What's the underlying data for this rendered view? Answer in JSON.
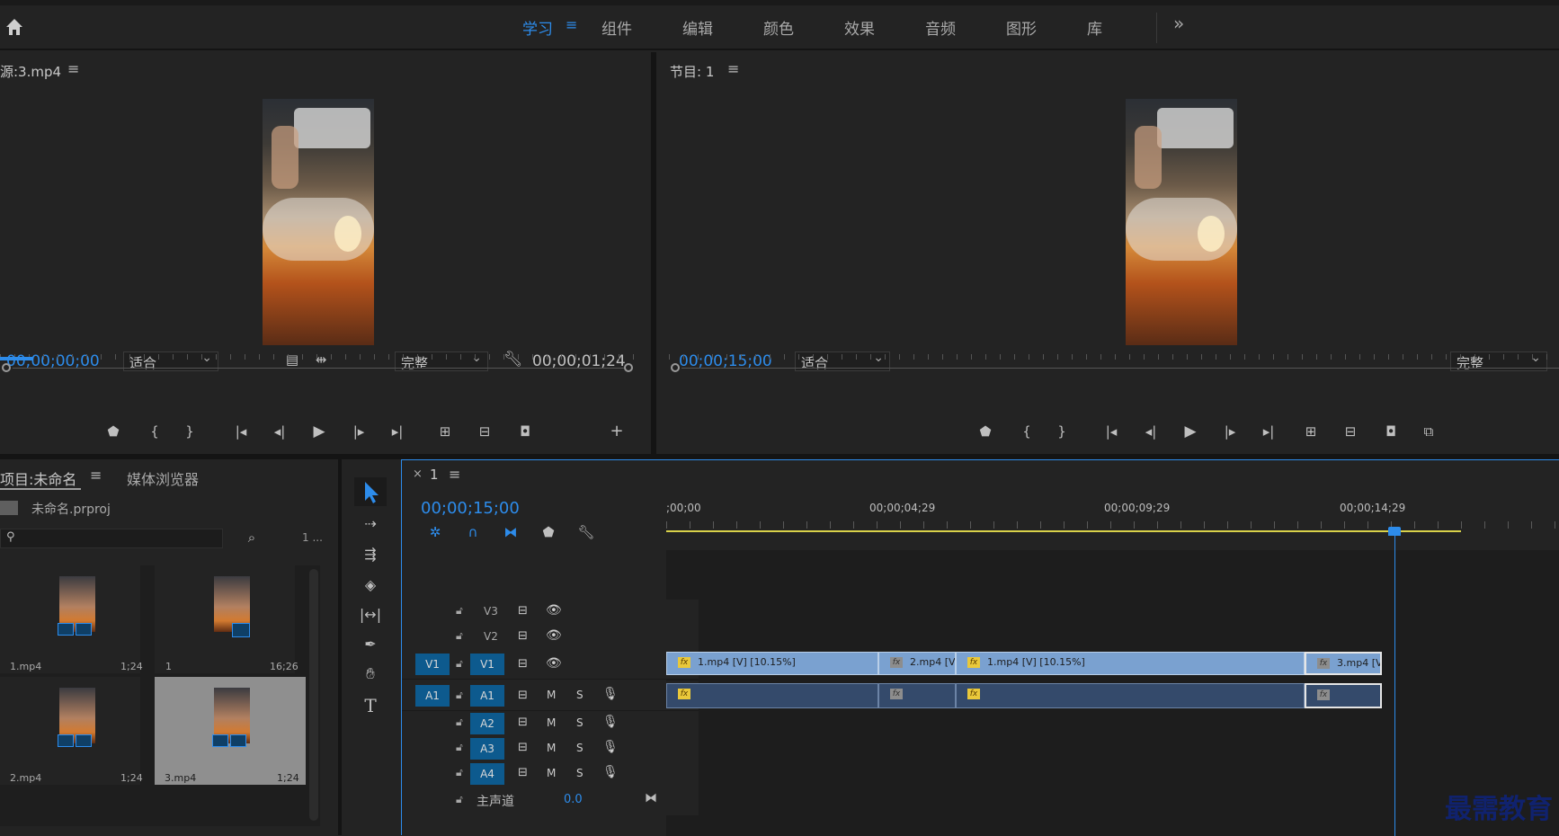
{
  "workspaces": {
    "tabs": [
      "学习",
      "组件",
      "编辑",
      "颜色",
      "效果",
      "音频",
      "图形",
      "库"
    ],
    "active": "学习",
    "more": "»"
  },
  "source": {
    "title": "源:3.mp4",
    "timecode": "00;00;00;00",
    "fit": "适合",
    "quality": "完整",
    "duration": "00;00;01;24"
  },
  "program": {
    "title": "节目: 1",
    "timecode": "00;00;15;00",
    "fit": "适合",
    "quality": "完整"
  },
  "project": {
    "tab_project": "项目:未命名",
    "tab_media": "媒体浏览器",
    "file": "未命名.prproj",
    "count": "1 ...",
    "items": [
      {
        "name": "1.mp4",
        "duration": "1;24"
      },
      {
        "name": "1",
        "duration": "16;26"
      },
      {
        "name": "2.mp4",
        "duration": "1;24"
      },
      {
        "name": "3.mp4",
        "duration": "1;24"
      }
    ]
  },
  "timeline": {
    "sequence": "1",
    "timecode": "00;00;15;00",
    "ruler": [
      ";00;00",
      "00;00;04;29",
      "00;00;09;29",
      "00;00;14;29"
    ],
    "playhead_fraction": 0.815,
    "video_tracks": [
      "V3",
      "V2",
      "V1"
    ],
    "audio_tracks": [
      "A1",
      "A2",
      "A3",
      "A4"
    ],
    "source_patch_v": "V1",
    "source_patch_a": "A1",
    "master_label": "主声道",
    "master_value": "0.0",
    "clips_v": [
      "1.mp4 [V] [10.15%]",
      "2.mp4 [V]",
      "1.mp4 [V] [10.15%]",
      "3.mp4 [V"
    ],
    "mute": "M",
    "solo": "S"
  },
  "watermark": "最需教育"
}
